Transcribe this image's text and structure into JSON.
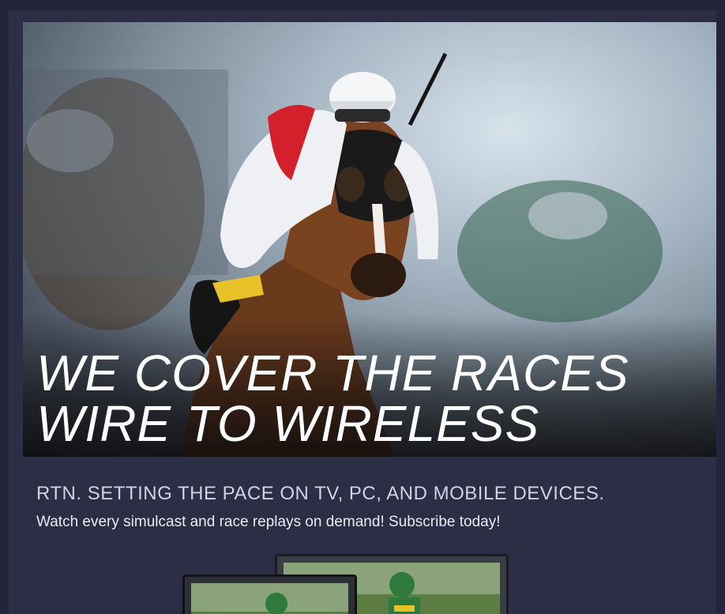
{
  "hero": {
    "image": "jockey-racing-horse-photo",
    "headline_line1": "WE COVER THE RACES",
    "headline_line2": "WIRE TO WIRELESS"
  },
  "promo": {
    "tagline": "RTN.  SETTING THE PACE ON TV, PC, AND MOBILE DEVICES.",
    "subline": "Watch every simulcast and race replays on demand! Subscribe today!"
  },
  "devices": {
    "image": "tv-and-monitor-showing-race-icon"
  },
  "colors": {
    "background": "#23253a",
    "headline": "#ffffff",
    "tagline": "#cfd3e2",
    "jockey_red": "#d4202a",
    "jockey_green": "#2e7a3c"
  }
}
